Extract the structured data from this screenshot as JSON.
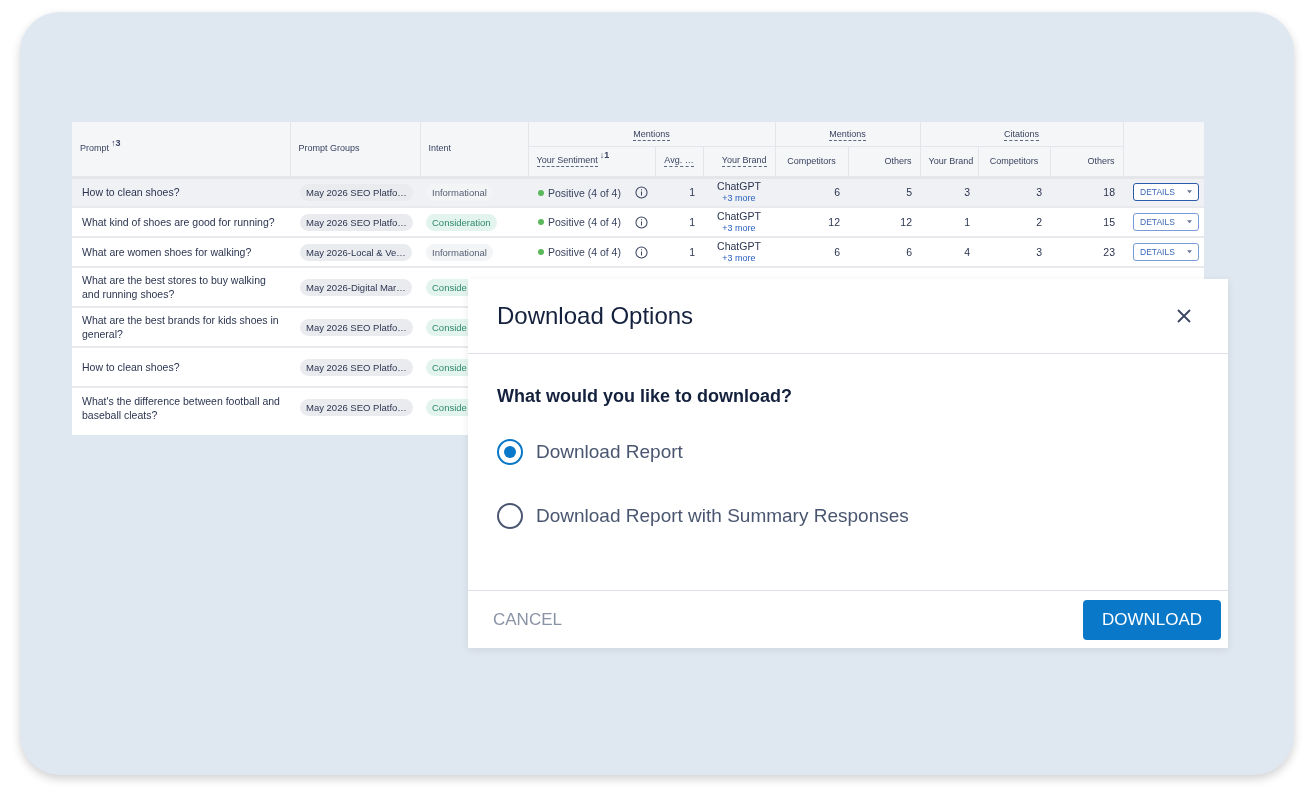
{
  "table": {
    "columns": [
      {
        "label": "Prompt",
        "sort_arrow": "↑",
        "sort_order": "3"
      },
      {
        "label": "Prompt Groups"
      },
      {
        "label": "Intent"
      }
    ],
    "groups": [
      {
        "label": "Mentions",
        "columns": [
          {
            "label": "Your Sentiment",
            "sort_arrow": "↓",
            "sort_order": "1"
          },
          {
            "label": "Avg. …"
          },
          {
            "label": "Your Brand"
          }
        ]
      },
      {
        "label": "Mentions",
        "columns": [
          {
            "label": "Competitors"
          },
          {
            "label": "Others"
          }
        ]
      },
      {
        "label": "Citations",
        "columns": [
          {
            "label": "Your Brand"
          },
          {
            "label": "Competitors"
          },
          {
            "label": "Others"
          }
        ]
      }
    ],
    "rows": [
      {
        "selected": true,
        "prompt": "How to clean shoes?",
        "group": "May 2026 SEO Platfo…",
        "intent": {
          "label": "Informational",
          "kind": "informational"
        },
        "sentiment": {
          "label": "Positive (4 of 4)",
          "color": "#5cb85c"
        },
        "avg": "1",
        "brand": "ChatGPT",
        "brand_more": "+3 more",
        "values": [
          "6",
          "5",
          "3",
          "3",
          "18"
        ],
        "action": "DETAILS"
      },
      {
        "selected": false,
        "prompt": "What kind of shoes are good for running?",
        "group": "May 2026 SEO Platfo…",
        "intent": {
          "label": "Consideration",
          "kind": "consideration"
        },
        "sentiment": {
          "label": "Positive (4 of 4)",
          "color": "#5cb85c"
        },
        "avg": "1",
        "brand": "ChatGPT",
        "brand_more": "+3 more",
        "values": [
          "12",
          "12",
          "1",
          "2",
          "15"
        ],
        "action": "DETAILS"
      },
      {
        "selected": false,
        "prompt": "What are women shoes for walking?",
        "group": "May 2026-Local & Ve…",
        "intent": {
          "label": "Informational",
          "kind": "informational"
        },
        "sentiment": {
          "label": "Positive (4 of 4)",
          "color": "#5cb85c"
        },
        "avg": "1",
        "brand": "ChatGPT",
        "brand_more": "+3 more",
        "values": [
          "6",
          "6",
          "4",
          "3",
          "23"
        ],
        "action": "DETAILS"
      },
      {
        "selected": false,
        "prompt": "What are the best stores to buy walking and running shoes?",
        "group": "May 2026-Digital Mar…",
        "intent": {
          "label": "Conside",
          "kind": "consideration"
        }
      },
      {
        "selected": false,
        "prompt": "What are the best brands for kids shoes in general?",
        "group": "May 2026 SEO Platfo…",
        "intent": {
          "label": "Conside",
          "kind": "consideration"
        }
      },
      {
        "selected": false,
        "prompt": "How to clean shoes?",
        "group": "May 2026 SEO Platfo…",
        "intent": {
          "label": "Conside",
          "kind": "consideration"
        }
      },
      {
        "selected": false,
        "prompt": "What's the difference between football and baseball cleats?",
        "group": "May 2026 SEO Platfo…",
        "intent": {
          "label": "Conside",
          "kind": "consideration"
        }
      }
    ]
  },
  "dialog": {
    "title": "Download Options",
    "question": "What would you like to download?",
    "options": [
      {
        "label": "Download Report",
        "selected": true
      },
      {
        "label": "Download Report with Summary Responses",
        "selected": false
      }
    ],
    "cancel": "CANCEL",
    "confirm": "DOWNLOAD"
  }
}
